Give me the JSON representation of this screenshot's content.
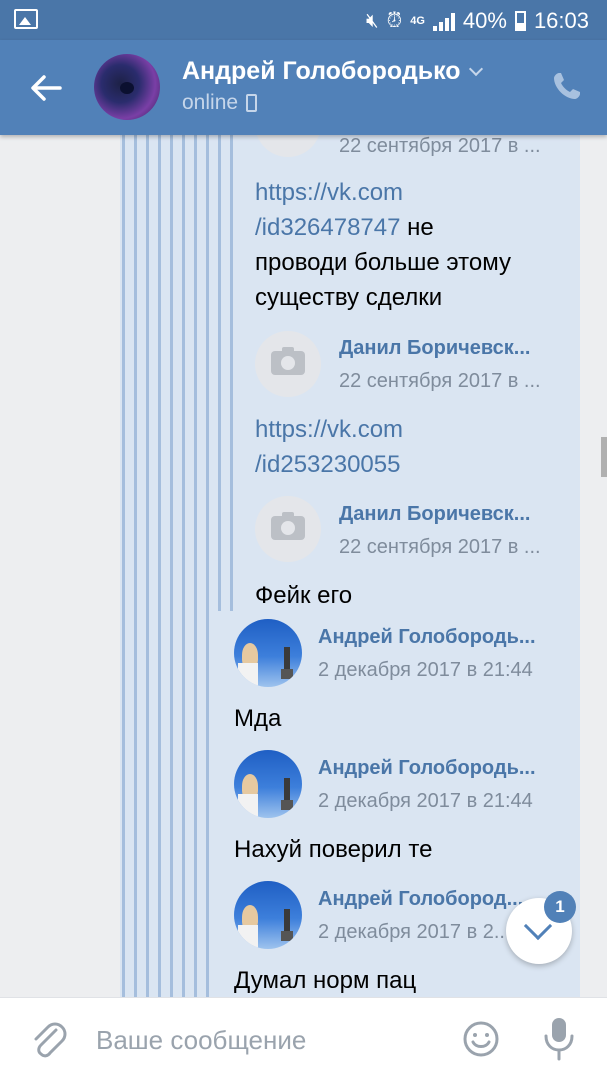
{
  "status_bar": {
    "battery": "40%",
    "time": "16:03",
    "network": "4G"
  },
  "header": {
    "title": "Андрей Голобородько",
    "subtitle": "online"
  },
  "messages": {
    "top_date": "22 сентября 2017 в ...",
    "fwd_msg1": {
      "link_line1": "https://vk.com",
      "link_line2": "/id326478747",
      "text_line1_tail": "не",
      "text_line2": "проводи больше этому",
      "text_line3": "существу сделки"
    },
    "fwd_author2": {
      "name": "Данил Боричевск...",
      "date": "22 сентября 2017 в ..."
    },
    "fwd_msg2": {
      "link_line1": "https://vk.com",
      "link_line2": "/id253230055"
    },
    "fwd_author3": {
      "name": "Данил Боричевск...",
      "date": "22 сентября 2017 в ..."
    },
    "fwd_msg3": {
      "text": "Фейк его"
    },
    "fwd_author4": {
      "name": "Андрей Голобородь...",
      "date": "2 декабря 2017 в 21:44"
    },
    "fwd_msg4": {
      "text": "Мда"
    },
    "fwd_author5": {
      "name": "Андрей Голобородь...",
      "date": "2 декабря 2017 в 21:44"
    },
    "fwd_msg5": {
      "text": "Нахуй поверил те"
    },
    "fwd_author6": {
      "name": "Андрей Голобород...",
      "date": "2 декабря 2017 в 2..."
    },
    "fwd_msg6": {
      "text": "Думал норм пац"
    }
  },
  "jump": {
    "badge_count": "1"
  },
  "composer": {
    "placeholder": "Ваше сообщение"
  },
  "colors": {
    "header": "#5181b8",
    "thread_bg": "#dae5f2",
    "link": "#4a76a8"
  },
  "icons": [
    "back-arrow-icon",
    "chevron-down-icon",
    "phone-icon",
    "camera-icon",
    "paperclip-icon",
    "emoji-icon",
    "microphone-icon",
    "arrow-down-icon"
  ]
}
